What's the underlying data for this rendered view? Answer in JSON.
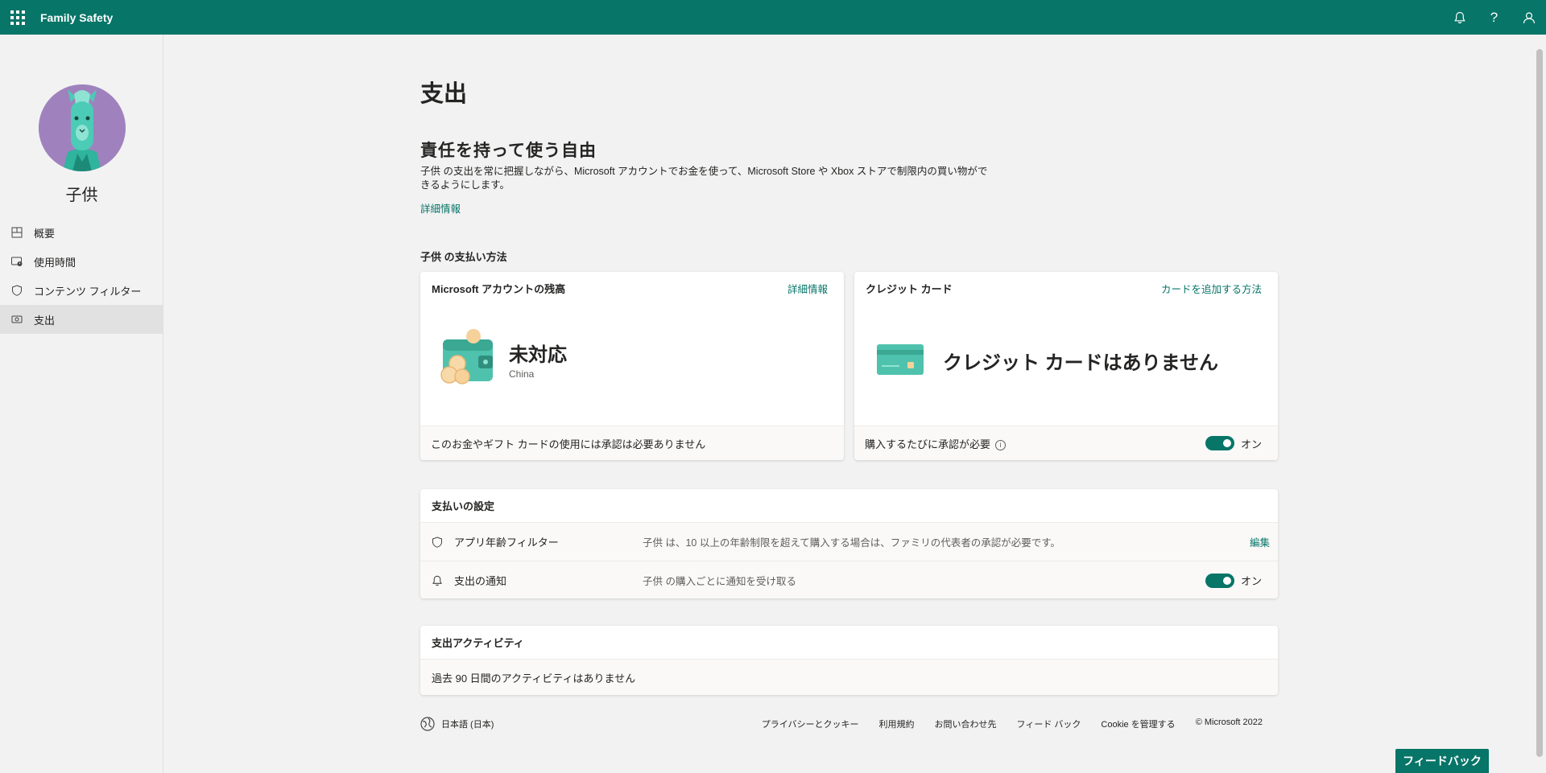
{
  "header": {
    "app_title": "Family Safety",
    "icons": [
      "waffle-icon",
      "bell-icon",
      "help-icon",
      "account-icon"
    ],
    "help_glyph": "?",
    "brand_color": "#077568"
  },
  "sidebar": {
    "child_name": "子供",
    "items": [
      {
        "label": "概要",
        "icon": "overview-icon"
      },
      {
        "label": "使用時間",
        "icon": "screen-time-icon"
      },
      {
        "label": "コンテンツ フィルター",
        "icon": "shield-icon"
      },
      {
        "label": "支出",
        "icon": "spending-icon"
      }
    ],
    "active_index": 3
  },
  "page": {
    "title": "支出",
    "hero_title": "責任を持って使う自由",
    "hero_desc": "子供 の支出を常に把握しながら、Microsoft アカウントでお金を使って、Microsoft Store や Xbox ストアで制限内の買い物ができるようにします。",
    "hero_link": "詳細情報",
    "payment_section_title": "子供 の支払い方法"
  },
  "balance_card": {
    "title": "Microsoft アカウントの残高",
    "link": "詳細情報",
    "value": "未対応",
    "region": "China",
    "footer_text": "このお金やギフト カードの使用には承認は必要ありません"
  },
  "credit_card": {
    "title": "クレジット カード",
    "link": "カードを追加する方法",
    "empty_text": "クレジット カードはありません",
    "footer_text": "購入するたびに承認が必要",
    "info_glyph": "i",
    "toggle_label": "オン",
    "toggle_on": true
  },
  "payment_settings": {
    "title": "支払いの設定",
    "rows": [
      {
        "icon": "shield-icon",
        "label": "アプリ年齢フィルター",
        "desc": "子供 は、10 以上の年齢制限を超えて購入する場合は、ファミリの代表者の承認が必要です。",
        "action": "編集"
      },
      {
        "icon": "bell-icon",
        "label": "支出の通知",
        "desc": "子供 の購入ごとに通知を受け取る",
        "toggle_label": "オン",
        "toggle_on": true
      }
    ]
  },
  "activity": {
    "title": "支出アクティビティ",
    "empty_text": "過去 90 日間のアクティビティはありません"
  },
  "footer": {
    "language": "日本語 (日本)",
    "links": [
      "プライバシーとクッキー",
      "利用規約",
      "お問い合わせ先",
      "フィード バック",
      "Cookie を管理する",
      "© Microsoft 2022"
    ]
  },
  "feedback_button": "フィードバック"
}
